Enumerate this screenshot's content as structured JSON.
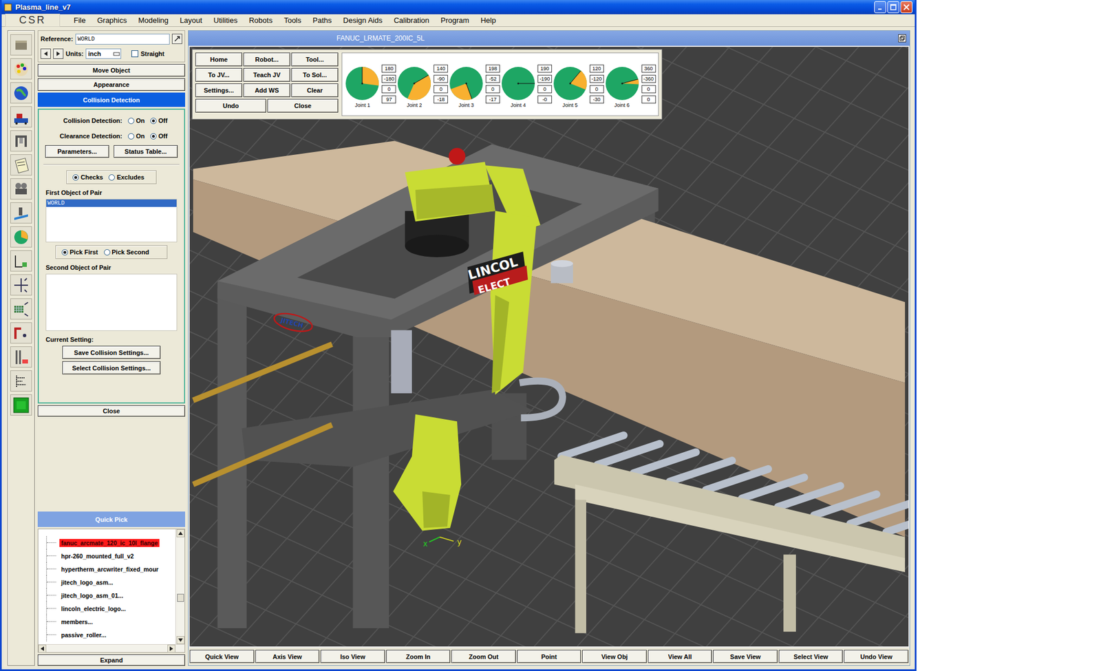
{
  "window": {
    "title": "Plasma_line_v7"
  },
  "menu": {
    "logo": "CSR",
    "items": [
      "File",
      "Graphics",
      "Modeling",
      "Layout",
      "Utilities",
      "Robots",
      "Tools",
      "Paths",
      "Design Aids",
      "Calibration",
      "Program",
      "Help"
    ]
  },
  "left_panel": {
    "reference": {
      "label": "Reference:",
      "value": "WORLD"
    },
    "units": {
      "label": "Units:",
      "value": "inch"
    },
    "straight": {
      "label": "Straight",
      "checked": false
    },
    "buttons": [
      "Move Object",
      "Appearance"
    ],
    "collision": {
      "title": "Collision Detection",
      "options": [
        {
          "label": "Collision Detection:",
          "choices": [
            {
              "label": "On",
              "selected": false
            },
            {
              "label": "Off",
              "selected": true
            }
          ]
        },
        {
          "label": "Clearance Detection:",
          "choices": [
            {
              "label": "On",
              "selected": false
            },
            {
              "label": "Off",
              "selected": true
            }
          ]
        }
      ],
      "buttons": [
        "Parameters...",
        "Status Table..."
      ],
      "mode": [
        {
          "label": "Checks",
          "selected": true
        },
        {
          "label": "Excludes",
          "selected": false
        }
      ],
      "first_label": "First Object of Pair",
      "first_items": [
        {
          "label": "WORLD",
          "selected": true
        }
      ],
      "pick": [
        {
          "label": "Pick First",
          "selected": true
        },
        {
          "label": "Pick Second",
          "selected": false
        }
      ],
      "second_label": "Second Object of Pair",
      "second_items": [],
      "current_label": "Current Setting:",
      "setting_buttons": [
        "Save Collision Settings...",
        "Select Collision Settings..."
      ],
      "close": "Close"
    },
    "quick_pick": {
      "title": "Quick Pick",
      "items": [
        {
          "label": "fanuc_arcmate_120_ic_10l_flange",
          "selected": true
        },
        {
          "label": "hpr-260_mounted_full_v2",
          "selected": false
        },
        {
          "label": "hypertherm_arcwriter_fixed_mour",
          "selected": false
        },
        {
          "label": "jitech_logo_asm...",
          "selected": false
        },
        {
          "label": "jitech_logo_asm_01...",
          "selected": false
        },
        {
          "label": "lincoln_electric_logo...",
          "selected": false
        },
        {
          "label": "members...",
          "selected": false
        },
        {
          "label": "passive_roller...",
          "selected": false
        }
      ],
      "expand": "Expand"
    }
  },
  "viewport": {
    "title": "FANUC_LRMATE_200IC_5L",
    "buttons": [
      "Quick View",
      "Axis View",
      "Iso View",
      "Zoom In",
      "Zoom Out",
      "Point",
      "View Obj",
      "View All",
      "Save View",
      "Select View",
      "Undo View"
    ]
  },
  "jog": {
    "rows": [
      [
        "Home",
        "Robot...",
        "Tool..."
      ],
      [
        "To JV...",
        "Teach JV",
        "To Sol..."
      ],
      [
        "Settings...",
        "Add WS",
        "Clear"
      ],
      [
        "Undo",
        "Close"
      ]
    ],
    "joints": [
      {
        "label": "Joint 1",
        "values": [
          "180",
          "-180",
          "0",
          "97"
        ],
        "start": 0,
        "level": 0.27
      },
      {
        "label": "Joint 2",
        "values": [
          "140",
          "-90",
          "0",
          "-18"
        ],
        "start": 60,
        "level": 0.4
      },
      {
        "label": "Joint 3",
        "values": [
          "198",
          "-52",
          "0",
          "-17"
        ],
        "start": 160,
        "level": 0.25
      },
      {
        "label": "Joint 4",
        "values": [
          "190",
          "-190",
          "0",
          "-0"
        ],
        "start": 90,
        "level": 0
      },
      {
        "label": "Joint 5",
        "values": [
          "120",
          "-120",
          "0",
          "-30"
        ],
        "start": 40,
        "level": 0.2
      },
      {
        "label": "Joint 6",
        "values": [
          "360",
          "-360",
          "0",
          "0"
        ],
        "start": 75,
        "level": 0.05
      }
    ]
  },
  "scene": {
    "logos": [
      "LINCOL",
      "ELECT",
      "JITECH"
    ],
    "axes": [
      "x",
      "y"
    ]
  }
}
